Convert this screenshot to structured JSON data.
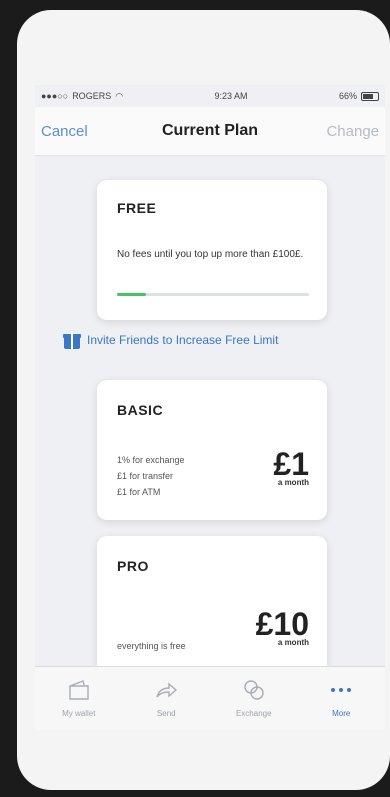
{
  "status": {
    "carrier": "ROGERS",
    "time": "9:23 AM",
    "battery": "66%"
  },
  "nav": {
    "cancel": "Cancel",
    "title": "Current Plan",
    "change": "Change"
  },
  "plans": {
    "free": {
      "title": "FREE",
      "description": "No fees until you top up more than £100£.",
      "progress": 0.15
    },
    "invite": {
      "label": "Invite Friends to Increase Free Limit"
    },
    "basic": {
      "title": "BASIC",
      "lines": [
        "1% for exchange",
        "£1 for transfer",
        "£1 for ATM"
      ],
      "price": "£1",
      "per": "a month"
    },
    "pro": {
      "title": "PRO",
      "line": "everything is free",
      "price": "£10",
      "per": "a month"
    }
  },
  "tabs": [
    {
      "label": "My wallet",
      "icon": "wallet-icon"
    },
    {
      "label": "Send",
      "icon": "send-icon"
    },
    {
      "label": "Exchange",
      "icon": "exchange-icon"
    },
    {
      "label": "More",
      "icon": "more-icon"
    }
  ],
  "colors": {
    "accent": "#3d76c4",
    "progress": "#46c463"
  }
}
